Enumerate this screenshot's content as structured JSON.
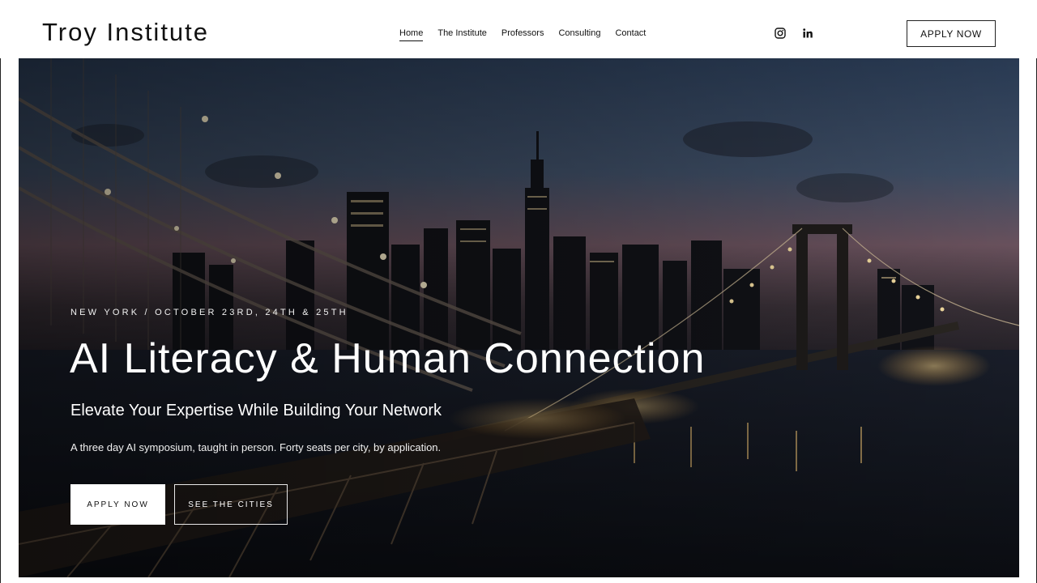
{
  "brand": {
    "name": "Troy Institute"
  },
  "nav": {
    "items": [
      {
        "label": "Home",
        "active": true
      },
      {
        "label": "The Institute"
      },
      {
        "label": "Professors"
      },
      {
        "label": "Consulting"
      },
      {
        "label": "Contact"
      }
    ]
  },
  "social": {
    "icons": [
      "instagram-icon",
      "linkedin-icon"
    ]
  },
  "header_cta": {
    "label": "APPLY NOW"
  },
  "hero": {
    "eyebrow": "NEW YORK / OCTOBER 23RD, 24TH & 25TH",
    "headline": "AI Literacy & Human Connection",
    "subhead": "Elevate Your Expertise While Building Your Network",
    "description": "A three day AI symposium, taught in person. Forty seats per city, by application.",
    "primary_button": "APPLY NOW",
    "secondary_button": "SEE THE CITIES"
  }
}
